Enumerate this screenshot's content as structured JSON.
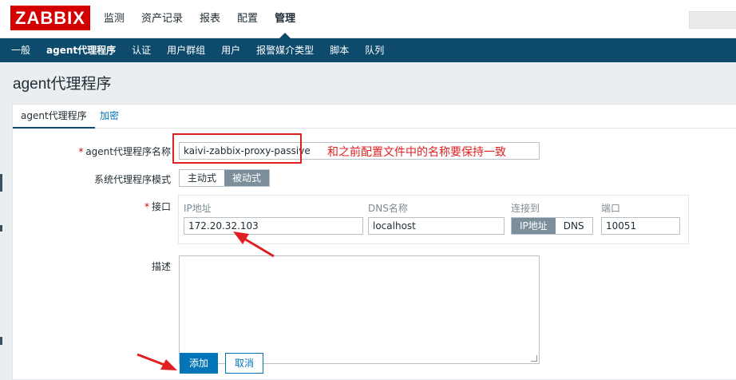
{
  "app": {
    "logo_text": "ZABBIX",
    "brand_color": "#d40000"
  },
  "main_nav": {
    "items": [
      "监测",
      "资产记录",
      "报表",
      "配置",
      "管理"
    ],
    "active": "管理"
  },
  "sub_nav": {
    "items": [
      "一般",
      "agent代理程序",
      "认证",
      "用户群组",
      "用户",
      "报警媒介类型",
      "脚本",
      "队列"
    ],
    "active": "agent代理程序",
    "background": "#0e4a6b"
  },
  "page": {
    "title": "agent代理程序"
  },
  "tabs": {
    "active": "agent代理程序",
    "other": "加密"
  },
  "form": {
    "name_label": "agent代理程序名称",
    "name_value": "kaivi-zabbix-proxy-passive",
    "mode_label": "系统代理程序模式",
    "mode_options": [
      "主动式",
      "被动式"
    ],
    "mode_selected": "被动式",
    "interface_label": "接口",
    "interface": {
      "ip_header": "IP地址",
      "dns_header": "DNS名称",
      "connect_header": "连接到",
      "port_header": "端口",
      "ip_value": "172.20.32.103",
      "dns_value": "localhost",
      "connect_options": [
        "IP地址",
        "DNS"
      ],
      "connect_selected": "IP地址",
      "port_value": "10051"
    },
    "description_label": "描述",
    "description_value": "",
    "required_mark": "*",
    "add_button": "添加",
    "cancel_button": "取消"
  },
  "annotation": {
    "text": "和之前配置文件中的名称要保持一致",
    "color": "#e02020"
  }
}
